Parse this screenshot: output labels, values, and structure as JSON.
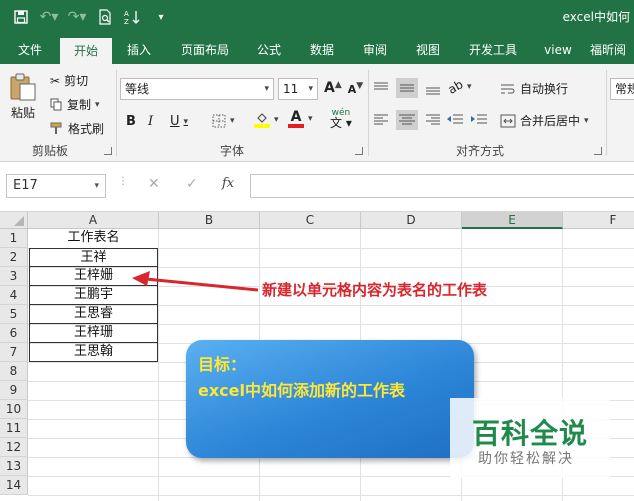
{
  "window": {
    "title": "excel中如何"
  },
  "quick_access": [
    {
      "icon": "save-icon"
    },
    {
      "icon": "undo-icon"
    },
    {
      "icon": "redo-icon"
    },
    {
      "icon": "print-preview-icon"
    },
    {
      "icon": "sort-icon"
    },
    {
      "icon": "customize-icon"
    }
  ],
  "tabs": [
    "文件",
    "开始",
    "插入",
    "页面布局",
    "公式",
    "数据",
    "审阅",
    "视图",
    "开发工具",
    "view",
    "福昕阅"
  ],
  "active_tab": "开始",
  "ribbon": {
    "clipboard": {
      "paste": "粘贴",
      "cut": "剪切",
      "copy": "复制",
      "format_painter": "格式刷",
      "label": "剪贴板"
    },
    "font": {
      "name": "等线",
      "size": "11",
      "label": "字体",
      "bold": "B",
      "italic": "I",
      "underline": "U",
      "font_color_letter": "A",
      "grow": "A",
      "shrink": "A",
      "phonetic": "wén",
      "fill_color": "#ffff00",
      "text_color": "#e02020"
    },
    "alignment": {
      "wrap": "自动换行",
      "merge": "合并后居中",
      "label": "对齐方式"
    },
    "number": {
      "format": "常规"
    }
  },
  "formula_bar": {
    "name_box": "E17",
    "cancel": "✕",
    "enter": "✓",
    "fx": "fx",
    "value": ""
  },
  "columns": [
    "A",
    "B",
    "C",
    "D",
    "E",
    "F"
  ],
  "selected_column": "E",
  "rows": [
    "1",
    "2",
    "3",
    "4",
    "5",
    "6",
    "7",
    "8",
    "9",
    "10",
    "11",
    "12",
    "13",
    "14"
  ],
  "cells_A": [
    "工作表名",
    "王祥",
    "王梓姗",
    "王鹏宇",
    "王思睿",
    "王梓珊",
    "王思翰"
  ],
  "annotation": "新建以单元格内容为表名的工作表",
  "callout": {
    "line1": "目标：",
    "line2": "excel中如何添加新的工作表"
  },
  "watermark": {
    "brand": "百科全说",
    "tagline": "助你轻松解决"
  },
  "colors": {
    "excel_green": "#217346",
    "annotation_red": "#d9262c",
    "callout_text": "#ffe733",
    "callout_blue": "#2d86d8"
  }
}
